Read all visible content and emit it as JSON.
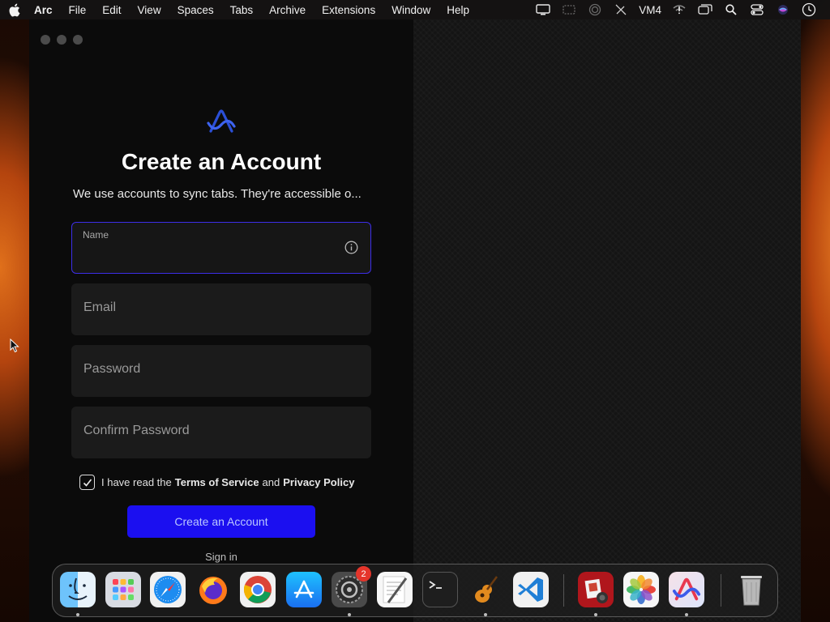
{
  "menubar": {
    "app_name": "Arc",
    "items": [
      "File",
      "Edit",
      "View",
      "Spaces",
      "Tabs",
      "Archive",
      "Extensions",
      "Window",
      "Help"
    ],
    "status_text": "VM4"
  },
  "signup": {
    "title": "Create an Account",
    "subtitle": "We use accounts to sync tabs. They're accessible o...",
    "name_label": "Name",
    "email_placeholder": "Email",
    "password_placeholder": "Password",
    "confirm_placeholder": "Confirm Password",
    "agree_prefix": "I have read the",
    "terms": "Terms of Service",
    "agree_and": "and",
    "privacy": "Privacy Policy",
    "terms_checked": true,
    "submit_label": "Create an Account",
    "signin_label": "Sign in"
  },
  "dock": {
    "apps": [
      "finder-icon",
      "launchpad-icon",
      "safari-icon",
      "firefox-icon",
      "chrome-icon",
      "app-store-icon",
      "system-settings-icon",
      "textedit-icon",
      "terminal-icon",
      "garageband-icon",
      "vscode-icon",
      "photo-booth-icon",
      "photos-icon",
      "arc-icon",
      "trash-icon"
    ],
    "settings_badge": "2"
  },
  "colors": {
    "accent": "#1b0ff0",
    "focus_border": "#3d2ee8"
  }
}
